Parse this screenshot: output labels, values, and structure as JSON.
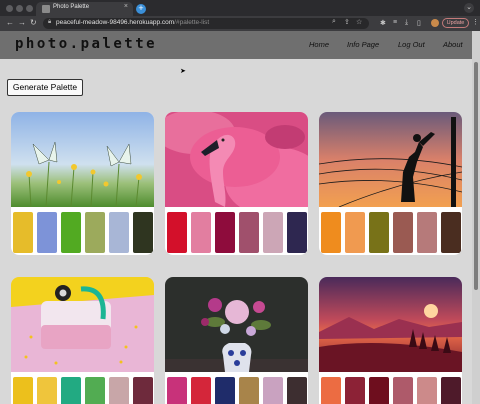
{
  "browser": {
    "tab_title": "Photo Palette",
    "tab_close": "×",
    "new_tab": "+",
    "url_host": "peaceful-meadow-98496.herokuapp.com",
    "url_path": "/#palette-list",
    "update_label": "Update",
    "icons": [
      "back-icon",
      "forward-icon",
      "reload-icon",
      "lock-icon",
      "search-icon",
      "share-icon",
      "star-icon",
      "extensions-icon",
      "sidebar-icon",
      "profile-avatar",
      "menu-icon"
    ]
  },
  "header": {
    "logo": "photo.palette",
    "nav": [
      "Home",
      "Info Page",
      "Log Out",
      "About"
    ]
  },
  "main": {
    "generate_label": "Generate Palette"
  },
  "cards": [
    {
      "subject": "butterflies",
      "swatches": [
        "#e6bc2a",
        "#7d93d8",
        "#52aa22",
        "#9caa5c",
        "#a8b6d6",
        "#2f3520"
      ]
    },
    {
      "subject": "flamingo",
      "swatches": [
        "#d3102a",
        "#e27ea0",
        "#8e0c3c",
        "#a0506c",
        "#cca6b6",
        "#2e2750"
      ]
    },
    {
      "subject": "power-line-worker",
      "swatches": [
        "#ef8c1e",
        "#f09a50",
        "#787218",
        "#9a5a52",
        "#b67a7a",
        "#4a2d20"
      ]
    },
    {
      "subject": "pink-bag",
      "swatches": [
        "#ecc01c",
        "#efc53c",
        "#22aa82",
        "#52ac52",
        "#c8a6a8",
        "#6e2a3c"
      ]
    },
    {
      "subject": "flower-vase",
      "swatches": [
        "#c8327a",
        "#d4263a",
        "#1f2c6a",
        "#a8844a",
        "#c9a2c0",
        "#3d2e30"
      ]
    },
    {
      "subject": "red-landscape",
      "swatches": [
        "#ec6c42",
        "#8c2236",
        "#6e0e1e",
        "#ae5a6a",
        "#cc8a8a",
        "#4e1a2a"
      ]
    }
  ]
}
